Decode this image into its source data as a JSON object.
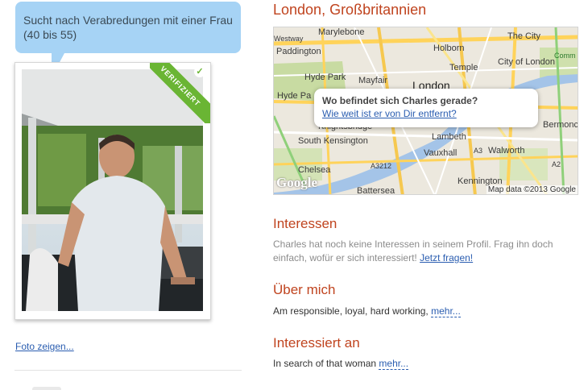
{
  "profile": {
    "looking_for": "Sucht nach Verabredungen mit einer Frau (40 bis 55)",
    "verified_badge": "VERIFIZIERT",
    "photo_link": "Foto zeigen..."
  },
  "location": {
    "title": "London, Großbritannien",
    "map": {
      "labels": {
        "marylebone": "Marylebone",
        "westway": "Westway",
        "paddington": "Paddington",
        "the_city": "The City",
        "holborn": "Holborn",
        "temple": "Temple",
        "city_of_london": "City of London",
        "hyde_park": "Hyde Park",
        "mayfair": "Mayfair",
        "london": "London",
        "hyde_park_2": "Hyde Pa",
        "knightsbridge": "Knightsbridge",
        "bermond": "Bermonc",
        "south_kensington": "South Kensington",
        "lambeth": "Lambeth",
        "vauxhall": "Vauxhall",
        "walworth": "Walworth",
        "chelsea": "Chelsea",
        "a3212": "A3212",
        "kennington": "Kennington",
        "battersea": "Battersea",
        "comm": "Comm",
        "a3": "A3",
        "a2": "A2"
      },
      "popup_question": "Wo befindet sich Charles gerade?",
      "popup_link": "Wie weit ist er von Dir entfernt?",
      "google_logo": "Google",
      "attribution": "Map data ©2013 Google"
    }
  },
  "interests": {
    "title": "Interessen",
    "text": "Charles hat noch keine Interessen in seinem Profil. Frag ihn doch einfach, wofür er sich interessiert!",
    "link": "Jetzt fragen!"
  },
  "about": {
    "title": "Über mich",
    "text": "Am responsible, loyal, hard working,",
    "more": "mehr..."
  },
  "interested_in": {
    "title": "Interessiert an",
    "text": "In search of that woman",
    "more": "mehr..."
  },
  "colors": {
    "accent": "#c0441f",
    "link": "#2a5db0",
    "bubble": "#a6d3f5",
    "verified": "#6ab534"
  }
}
